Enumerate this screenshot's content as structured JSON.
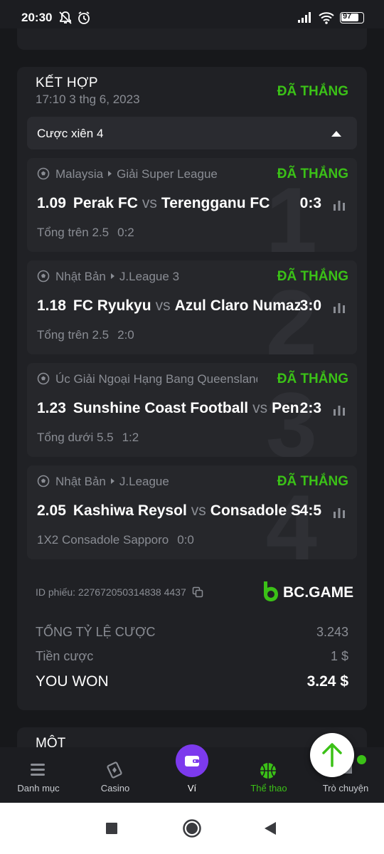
{
  "status_bar": {
    "time": "20:30",
    "battery": "97"
  },
  "bet": {
    "type_label": "KẾT HỢP",
    "date": "17:10 3 thg 6, 2023",
    "status": "ĐÃ THẮNG",
    "parlay_label": "Cược xiên 4",
    "legs": [
      {
        "num": "1",
        "country": "Malaysia",
        "league": "Giải Super League",
        "status": "ĐÃ THẮNG",
        "odds": "1.09",
        "home": "Perak FC",
        "vs": "vs",
        "away": "Terengganu FC",
        "score": "0:3",
        "market": "Tổng trên 2.5",
        "market_score": "0:2"
      },
      {
        "num": "2",
        "country": "Nhật Bản",
        "league": "J.League 3",
        "status": "ĐÃ THẮNG",
        "odds": "1.18",
        "home": "FC Ryukyu",
        "vs": "vs",
        "away": "Azul Claro Numazu",
        "score": "3:0",
        "market": "Tổng trên 2.5",
        "market_score": "2:0"
      },
      {
        "num": "3",
        "country": "Úc",
        "league": "Giải Ngoại Hạng Bang Queensland",
        "status": "ĐÃ THẮNG",
        "odds": "1.23",
        "home": "Sunshine Coast Football",
        "vs": "vs",
        "away": "Peninsula Power",
        "score": "2:3",
        "market": "Tổng dưới 5.5",
        "market_score": "1:2"
      },
      {
        "num": "4",
        "country": "Nhật Bản",
        "league": "J.League",
        "status": "ĐÃ THẮNG",
        "odds": "2.05",
        "home": "Kashiwa Reysol",
        "vs": "vs",
        "away": "Consadole Sapporo",
        "score": "4:5",
        "market": "1X2 Consadole Sapporo",
        "market_score": "0:0"
      }
    ],
    "ticket_id": "ID phiếu: 227672050314838 4437",
    "brand": "BC.GAME",
    "total_odds_label": "TỔNG TỶ LỆ CƯỢC",
    "total_odds_value": "3.243",
    "stake_label": "Tiền cược",
    "stake_value": "1 $",
    "won_label": "YOU WON",
    "won_value": "3.24 $"
  },
  "next_bet": {
    "type_label": "MỘT"
  },
  "bottom_nav": {
    "items": [
      {
        "label": "Danh mục",
        "icon": "menu-icon"
      },
      {
        "label": "Casino",
        "icon": "casino-icon"
      },
      {
        "label": "Ví",
        "icon": "wallet-icon"
      },
      {
        "label": "Thể thao",
        "icon": "basketball-icon"
      },
      {
        "label": "Trò chuyện",
        "icon": "chat-icon"
      }
    ]
  },
  "colors": {
    "accent_green": "#3bc117",
    "wallet_purple": "#7c3aed",
    "bg": "#17181b",
    "card": "#202125"
  }
}
